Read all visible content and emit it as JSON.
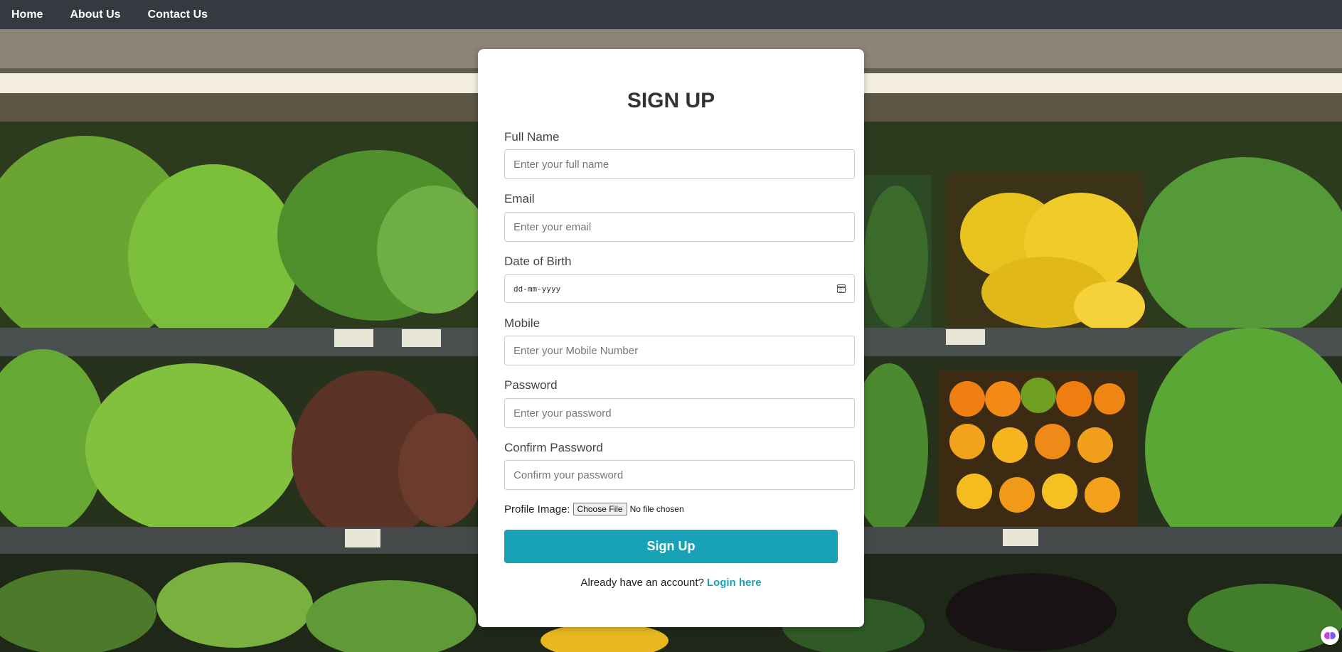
{
  "nav": {
    "items": [
      {
        "label": "Home"
      },
      {
        "label": "About Us"
      },
      {
        "label": "Contact Us"
      }
    ]
  },
  "form": {
    "title": "SIGN UP",
    "full_name": {
      "label": "Full Name",
      "placeholder": "Enter your full name"
    },
    "email": {
      "label": "Email",
      "placeholder": "Enter your email"
    },
    "dob": {
      "label": "Date of Birth",
      "format": "dd-mm-yyyy"
    },
    "mobile": {
      "label": "Mobile",
      "placeholder": "Enter your Mobile Number"
    },
    "password": {
      "label": "Password",
      "placeholder": "Enter your password"
    },
    "confirm_password": {
      "label": "Confirm Password",
      "placeholder": "Confirm your password"
    },
    "profile_image": {
      "label": "Profile Image:",
      "button": "Choose File",
      "status": "No file chosen"
    },
    "submit_label": "Sign Up",
    "login_prompt": "Already have an account?",
    "login_link": "Login here"
  },
  "colors": {
    "navbar": "#343a40",
    "accent": "#17a2b8",
    "card": "#ffffff"
  },
  "icons": {
    "calendar": "calendar-icon",
    "extension": "brain-extension-icon"
  }
}
